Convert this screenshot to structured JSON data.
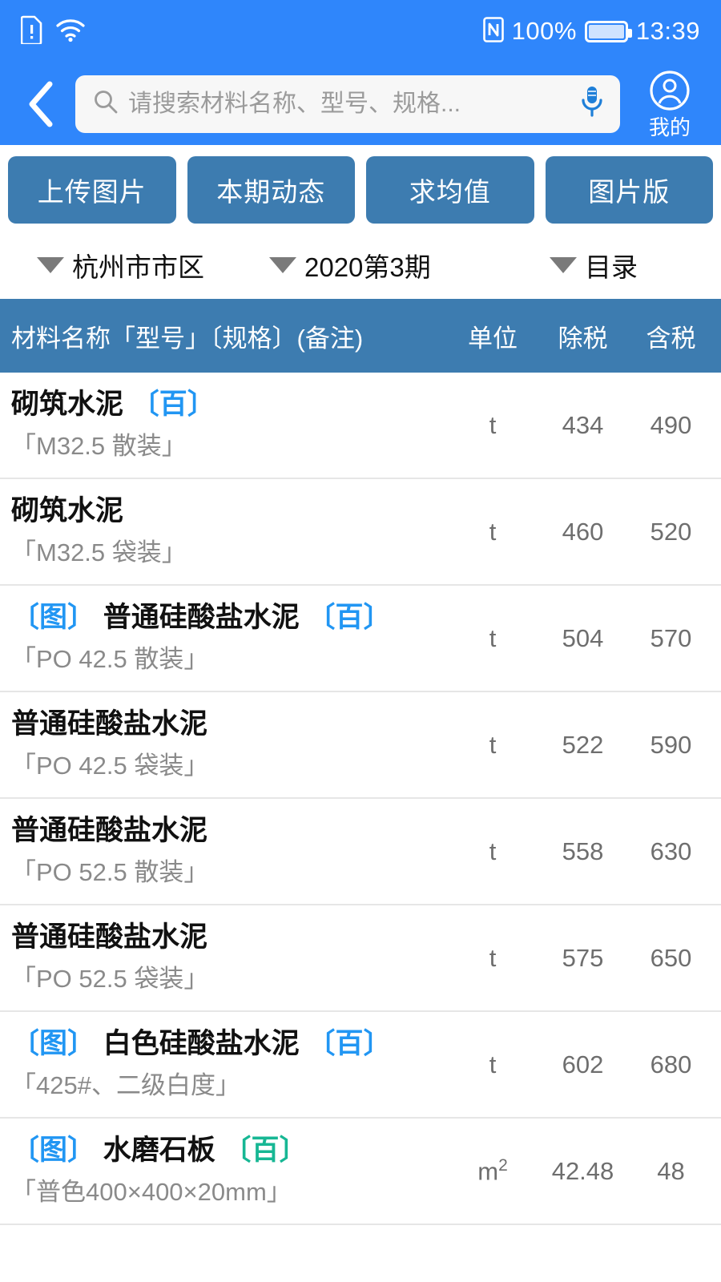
{
  "statusbar": {
    "left_icons": [
      "sim-card-alert-icon",
      "wifi-icon"
    ],
    "nfc_icon": "nfc-icon",
    "battery_percent": "100%",
    "battery_icon": "battery-full-icon",
    "time": "13:39"
  },
  "appbar": {
    "back_icon": "back-chevron-icon",
    "search": {
      "icon": "search-icon",
      "placeholder": "请搜索材料名称、型号、规格...",
      "value": "",
      "mic_icon": "microphone-icon"
    },
    "profile": {
      "icon": "account-circle-icon",
      "label": "我的"
    }
  },
  "actions": [
    {
      "label": "上传图片"
    },
    {
      "label": "本期动态"
    },
    {
      "label": "求均值"
    },
    {
      "label": "图片版"
    }
  ],
  "filters": [
    {
      "label": "杭州市市区",
      "caret": "chevron-down-icon"
    },
    {
      "label": "2020第3期",
      "caret": "chevron-down-icon"
    },
    {
      "label": "目录",
      "caret": "chevron-down-icon"
    }
  ],
  "table": {
    "headers": {
      "name": "材料名称「型号」〔规格〕(备注)",
      "unit": "单位",
      "ex_tax": "除税",
      "in_tax": "含税"
    },
    "rows": [
      {
        "img_tag": "",
        "name": "砌筑水泥",
        "bai_tag": "〔百〕",
        "bai_color": "#2196F3",
        "spec": "「M32.5 散装」",
        "unit": "t",
        "ex_tax": "434",
        "in_tax": "490"
      },
      {
        "img_tag": "",
        "name": "砌筑水泥",
        "bai_tag": "",
        "bai_color": "#2196F3",
        "spec": "「M32.5 袋装」",
        "unit": "t",
        "ex_tax": "460",
        "in_tax": "520"
      },
      {
        "img_tag": "〔图〕",
        "name": "普通硅酸盐水泥",
        "bai_tag": "〔百〕",
        "bai_color": "#2196F3",
        "spec": "「PO 42.5 散装」",
        "unit": "t",
        "ex_tax": "504",
        "in_tax": "570"
      },
      {
        "img_tag": "",
        "name": "普通硅酸盐水泥",
        "bai_tag": "",
        "bai_color": "#2196F3",
        "spec": "「PO 42.5 袋装」",
        "unit": "t",
        "ex_tax": "522",
        "in_tax": "590"
      },
      {
        "img_tag": "",
        "name": "普通硅酸盐水泥",
        "bai_tag": "",
        "bai_color": "#2196F3",
        "spec": "「PO 52.5 散装」",
        "unit": "t",
        "ex_tax": "558",
        "in_tax": "630"
      },
      {
        "img_tag": "",
        "name": "普通硅酸盐水泥",
        "bai_tag": "",
        "bai_color": "#2196F3",
        "spec": "「PO 52.5 袋装」",
        "unit": "t",
        "ex_tax": "575",
        "in_tax": "650"
      },
      {
        "img_tag": "〔图〕",
        "name": "白色硅酸盐水泥",
        "bai_tag": "〔百〕",
        "bai_color": "#2196F3",
        "spec": "「425#、二级白度」",
        "unit": "t",
        "ex_tax": "602",
        "in_tax": "680"
      },
      {
        "img_tag": "〔图〕",
        "name": "水磨石板",
        "bai_tag": "〔百〕",
        "bai_color": "#17b794",
        "spec": "「普色400×400×20mm」",
        "unit": "m²",
        "ex_tax": "42.48",
        "in_tax": "48"
      }
    ]
  },
  "colors": {
    "header_blue": "#2f86fb",
    "button_blue": "#3d7cb0",
    "link_blue": "#2196F3",
    "tag_teal": "#17b794"
  }
}
